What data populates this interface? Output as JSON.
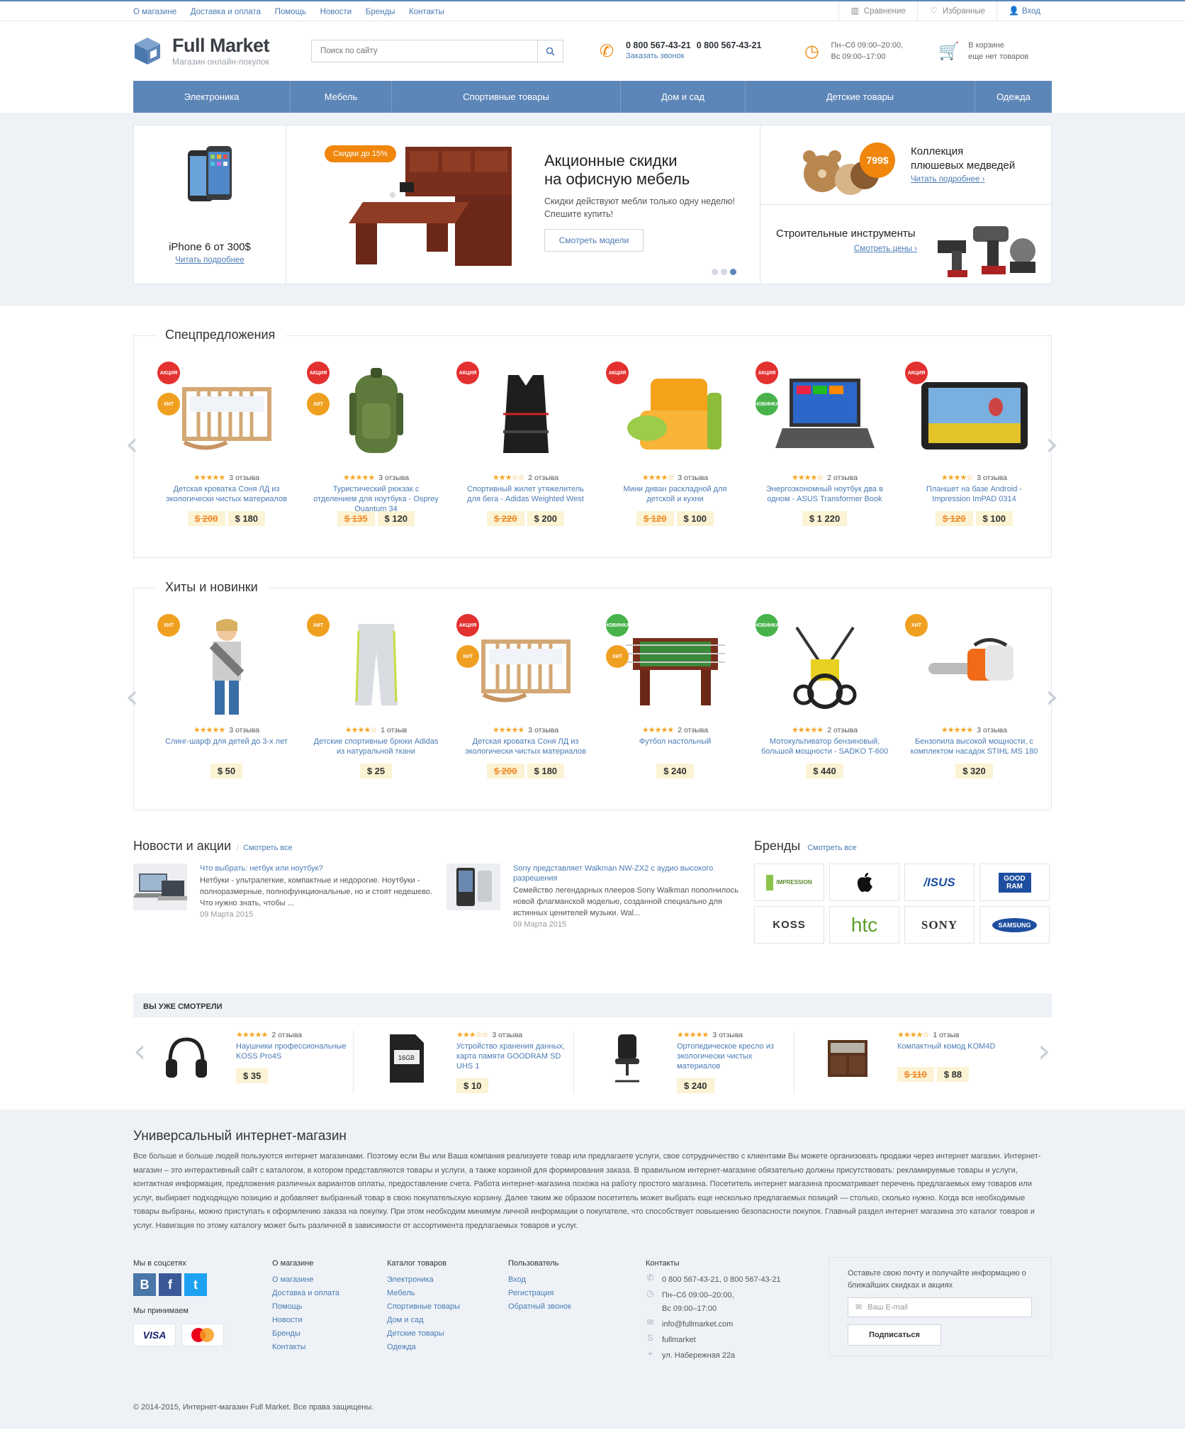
{
  "topbar": {
    "links": [
      "О магазине",
      "Доставка и оплата",
      "Помощь",
      "Новости",
      "Бренды",
      "Контакты"
    ],
    "compare": "Сравнение",
    "favorites": "Избранные",
    "login": "Вход"
  },
  "header": {
    "logo_name": "Full Market",
    "logo_sub": "Магазин онлайн-покупок",
    "search_placeholder": "Поиск по сайту",
    "phone1": "0 800 567-43-21",
    "phone2": "0 800 567-43-21",
    "callback": "Заказать звонок",
    "hours1": "Пн–Сб 09:00–20:00,",
    "hours2": "Вс 09:00–17:00",
    "cart1": "В корзине",
    "cart2": "еще нет товаров"
  },
  "nav": [
    "Электроника",
    "Мебель",
    "Спортивные товары",
    "Дом и сад",
    "Детские товары",
    "Одежда"
  ],
  "hero": {
    "left_title": "iPhone 6 от 300$",
    "left_link": "Читать подробнее",
    "badge": "Скидки до 15%",
    "title1": "Акционные скидки",
    "title2": "на офисную мебель",
    "desc": "Скидки действуют мебли только одну неделю! Спешите купить!",
    "button": "Смотреть модели",
    "r1_price": "799$",
    "r1_title1": "Коллекция",
    "r1_title2": "плюшевых медведей",
    "r1_link": "Читать подробнее",
    "r2_title": "Строительные инструменты",
    "r2_link": "Смотреть цены"
  },
  "special": {
    "title": "Спецпредложения",
    "items": [
      {
        "name": "Детская кроватка Соня ЛД из экологически чистых материалов",
        "reviews": "3 отзыва",
        "stars": "★★★★★",
        "old": "$ 200",
        "price": "$ 180",
        "tags": [
          "АКЦИЯ",
          "ХИТ"
        ]
      },
      {
        "name": "Туристический рюкзак с отделением для ноутбука - Osprey Quantum 34",
        "reviews": "3 отзыва",
        "stars": "★★★★★",
        "old": "$ 135",
        "price": "$ 120",
        "tags": [
          "АКЦИЯ",
          "ХИТ"
        ]
      },
      {
        "name": "Спортивный жилет утяжелитель для бега - Adidas Weighted West",
        "reviews": "2 отзыва",
        "stars": "★★★☆☆",
        "old": "$ 220",
        "price": "$ 200",
        "tags": [
          "АКЦИЯ"
        ]
      },
      {
        "name": "Мини диван раскладной для детской и кухни",
        "reviews": "3 отзыва",
        "stars": "★★★★☆",
        "old": "$ 120",
        "price": "$ 100",
        "tags": [
          "АКЦИЯ"
        ]
      },
      {
        "name": "Энергоэкономный ноутбук два в одном - ASUS Transformer Book",
        "reviews": "2 отзыва",
        "stars": "★★★★☆",
        "old": "",
        "price": "$ 1 220",
        "tags": [
          "АКЦИЯ",
          "НОВИНКА"
        ]
      },
      {
        "name": "Планшет на базе Android - Impression ImPAD 0314",
        "reviews": "3 отзыва",
        "stars": "★★★★☆",
        "old": "$ 120",
        "price": "$ 100",
        "tags": [
          "АКЦИЯ"
        ]
      }
    ]
  },
  "hits": {
    "title": "Хиты и новинки",
    "items": [
      {
        "name": "Слинг-шарф для детей до 3-х лет",
        "reviews": "3 отзыва",
        "stars": "★★★★★",
        "old": "",
        "price": "$ 50"
      },
      {
        "name": "Детские спортивные брюки Adidas из натуральной ткани",
        "reviews": "1 отзыв",
        "stars": "★★★★☆",
        "old": "",
        "price": "$ 25"
      },
      {
        "name": "Детская кроватка Соня ЛД из экологически чистых материалов",
        "reviews": "3 отзыва",
        "stars": "★★★★★",
        "old": "$ 200",
        "price": "$ 180"
      },
      {
        "name": "Футбол настольный",
        "reviews": "2 отзыва",
        "stars": "★★★★★",
        "old": "",
        "price": "$ 240"
      },
      {
        "name": "Мотокультиватор бензиновый, большой мощности - SADKO T-600",
        "reviews": "2 отзыва",
        "stars": "★★★★★",
        "old": "",
        "price": "$ 440"
      },
      {
        "name": "Бензопила высокой мощности, с комплектом насадок STIHL MS 180",
        "reviews": "3 отзыва",
        "stars": "★★★★★",
        "old": "",
        "price": "$ 320"
      }
    ]
  },
  "news": {
    "title": "Новости и акции",
    "all": "Смотреть все",
    "items": [
      {
        "title": "Что выбрать: нетбук или ноутбук?",
        "text": "Нетбуки - ультралегкие, компактные и недорогие. Ноутбуки - полноразмерные, полнофункциональные, но и стоят недешево. Что нужно знать, чтобы ...",
        "date": "09 Марта 2015"
      },
      {
        "title": "Sony представляет Walkman NW-ZX2 с аудио высокого разрешения",
        "text": "Семейство легендарных плееров Sony Walkman пополнилось новой флагманской моделью, созданной специально для истинных ценителей музыки. Wal...",
        "date": "09 Марта 2015"
      }
    ]
  },
  "brands": {
    "title": "Бренды",
    "all": "Смотреть все",
    "items": [
      "IMPRESSION",
      "",
      "/ISUS",
      "GOOD RAM",
      "KOSS",
      "htc",
      "SONY",
      "SAMSUNG"
    ]
  },
  "seen": {
    "title": "ВЫ УЖЕ СМОТРЕЛИ",
    "items": [
      {
        "name": "Наушники профессиональные KOSS Pro4S",
        "reviews": "2 отзыва",
        "stars": "★★★★★",
        "old": "",
        "price": "$ 35"
      },
      {
        "name": "Устройство хранения данных, карта памяти GOODRAM SD UHS 1",
        "reviews": "3 отзыва",
        "stars": "★★★☆☆",
        "old": "",
        "price": "$ 10"
      },
      {
        "name": "Ортопедическое кресло из экологически чистых материалов",
        "reviews": "3 отзыва",
        "stars": "★★★★★",
        "old": "",
        "price": "$ 240"
      },
      {
        "name": "Компактный комод KOM4D",
        "reviews": "1 отзыв",
        "stars": "★★★★☆",
        "old": "$ 110",
        "price": "$ 88"
      }
    ]
  },
  "footer": {
    "title": "Универсальный интернет-магазин",
    "text": "Все больше и больше людей пользуются интернет магазинами. Поэтому если Вы или Ваша компания реализуете товар или предлагаете услуги, свое сотрудничество с клиентами Вы можете организовать продажи через интернет магазин. Интернет-магазин – это интерактивный сайт с каталогом, в котором представляются товары и услуги, а также корзиной для формирования заказа. В правильном интернет-магазине обязательно должны присутствовать: рекламируемые товары и услуги, контактная информация, предложения различных вариантов оплаты, предоставление счета. Работа интернет-магазина похожа на работу простого магазина. Посетитель интернет магазина просматривает перечень предлагаемых ему товаров или услуг, выбирает подходящую позицию и добавляет выбранный товар в свою покупательскую корзину. Далее таким же образом посетитель может выбрать еще несколько предлагаемых позиций — столько, сколько нужно. Когда все необходимые товары выбраны, можно приступать к оформлению заказа на покупку. При этом необходим минимум личной информации о покупателе, что способствует повышению безопасности покупок. Главный раздел интернет магазина это каталог товаров и услуг. Навигация по этому каталогу может быть различной в зависимости от ассортимента предлагаемых товаров и услуг.",
    "social_title": "Мы в соцсетях",
    "pay_title": "Мы принимаем",
    "col_about": {
      "title": "О магазине",
      "links": [
        "О магазине",
        "Доставка и оплата",
        "Помощь",
        "Новости",
        "Бренды",
        "Контакты"
      ]
    },
    "col_catalog": {
      "title": "Каталог товаров",
      "links": [
        "Электроника",
        "Мебель",
        "Спортивные товары",
        "Дом и сад",
        "Детские товары",
        "Одежда"
      ]
    },
    "col_user": {
      "title": "Пользователь",
      "links": [
        "Вход",
        "Регистрация",
        "Обратный звонок"
      ]
    },
    "contacts": {
      "title": "Контакты",
      "phones": "0 800 567-43-21, 0 800 567-43-21",
      "hours1": "Пн–Сб 09:00–20:00,",
      "hours2": "Вс 09:00–17:00",
      "email": "info@fullmarket.com",
      "skype": "fullmarket",
      "address": "ул. Набережная 22а"
    },
    "subscribe_text": "Оставьте свою почту и получайте информацию о ближайших скидках и акциях",
    "email_placeholder": "Ваш E-mail",
    "subscribe_btn": "Подписаться",
    "copyright": "© 2014-2015, Интернет-магазин Full Market. Все права защищены."
  },
  "colors": {
    "accent": "#5d86b8",
    "orange": "#f0860c",
    "sale": "#e3312f",
    "hit": "#f0a020",
    "new": "#48b34b",
    "price_bg": "#fbf3d3"
  }
}
